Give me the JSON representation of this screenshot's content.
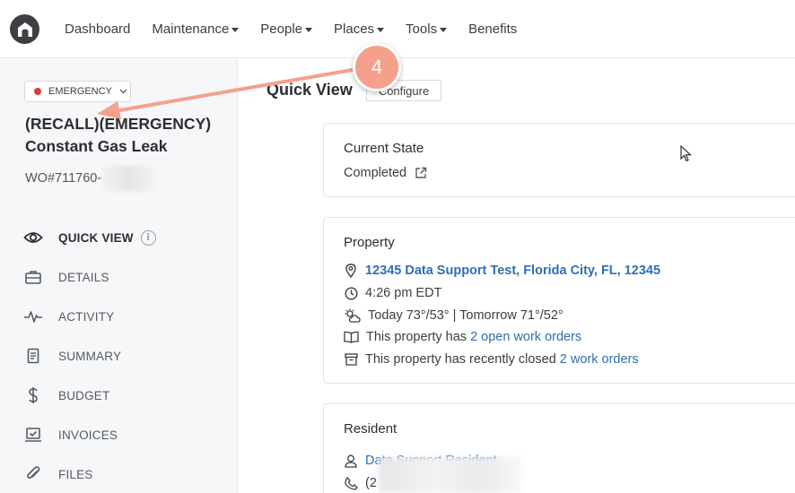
{
  "nav": {
    "items": [
      {
        "label": "Dashboard",
        "dropdown": false
      },
      {
        "label": "Maintenance",
        "dropdown": true
      },
      {
        "label": "People",
        "dropdown": true
      },
      {
        "label": "Places",
        "dropdown": true
      },
      {
        "label": "Tools",
        "dropdown": true
      },
      {
        "label": "Benefits",
        "dropdown": false
      }
    ]
  },
  "sidebar": {
    "priority_label": "EMERGENCY",
    "priority_color": "#e0393e",
    "wo_title": "(RECALL)(EMERGENCY) Constant Gas Leak",
    "wo_number": "WO#711760-",
    "menu": [
      {
        "label": "QUICK VIEW",
        "icon": "eye-icon",
        "active": true
      },
      {
        "label": "DETAILS",
        "icon": "briefcase-icon",
        "active": false
      },
      {
        "label": "ACTIVITY",
        "icon": "pulse-icon",
        "active": false
      },
      {
        "label": "SUMMARY",
        "icon": "document-icon",
        "active": false
      },
      {
        "label": "BUDGET",
        "icon": "dollar-icon",
        "active": false
      },
      {
        "label": "INVOICES",
        "icon": "invoice-icon",
        "active": false
      },
      {
        "label": "FILES",
        "icon": "paperclip-icon",
        "active": false
      }
    ],
    "info_glyph": "i"
  },
  "main": {
    "title": "Quick View",
    "configure_label": "Configure",
    "current_state": {
      "title": "Current State",
      "value": "Completed"
    },
    "property": {
      "title": "Property",
      "address": "12345 Data Support Test, Florida City, FL, 12345",
      "time": "4:26 pm EDT",
      "weather": "Today 73°/53° | Tomorrow 71°/52°",
      "open_prefix": "This property has ",
      "open_link": "2 open work orders",
      "closed_prefix": "This property has recently closed ",
      "closed_link": "2 work orders"
    },
    "resident": {
      "title": "Resident",
      "name_partial": "Data Support Resident",
      "phone_partial": "(2"
    }
  },
  "annotation": {
    "step_number": "4",
    "color": "#f4a08d"
  }
}
